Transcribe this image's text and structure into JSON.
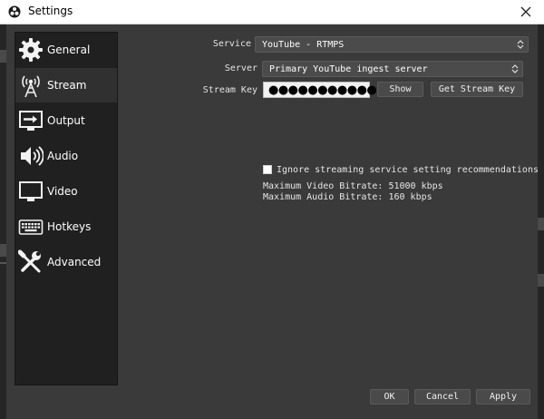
{
  "window": {
    "title": "Settings"
  },
  "sidebar": {
    "items": [
      {
        "label": "General",
        "icon": "gear-icon"
      },
      {
        "label": "Stream",
        "icon": "broadcast-tower-icon",
        "active": true
      },
      {
        "label": "Output",
        "icon": "output-monitor-icon"
      },
      {
        "label": "Audio",
        "icon": "speaker-icon"
      },
      {
        "label": "Video",
        "icon": "monitor-icon"
      },
      {
        "label": "Hotkeys",
        "icon": "keyboard-icon"
      },
      {
        "label": "Advanced",
        "icon": "tools-icon"
      }
    ]
  },
  "stream": {
    "service_label": "Service",
    "service_value": "YouTube - RTMPS",
    "server_label": "Server",
    "server_value": "Primary YouTube ingest server",
    "key_label": "Stream Key",
    "key_value": "●●●●●●●●●●●●",
    "show_button": "Show",
    "get_key_button": "Get Stream Key",
    "ignore_checkbox_label": "Ignore streaming service setting recommendations",
    "ignore_checked": false,
    "max_video_bitrate": "Maximum Video Bitrate: 51000 kbps",
    "max_audio_bitrate": "Maximum Audio Bitrate: 160 kbps"
  },
  "footer": {
    "ok": "OK",
    "cancel": "Cancel",
    "apply": "Apply"
  },
  "colors": {
    "window_bg": "#3a3a3a",
    "sidebar_bg": "#202020",
    "active_item": "#303030",
    "titlebar": "#ffffff"
  }
}
